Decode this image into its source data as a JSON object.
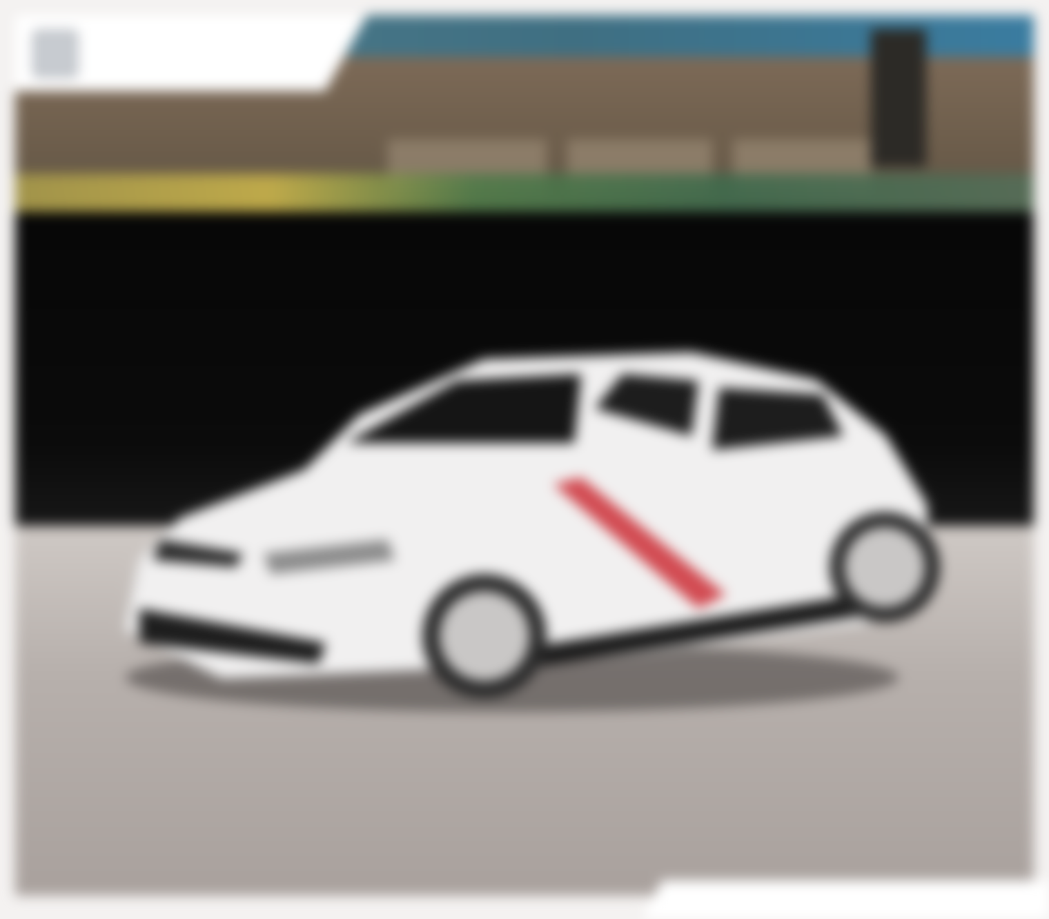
{
  "brand": {
    "badge_icon": "lion-badge-icon",
    "wordmark": "",
    "wordmark_color": "#d32637"
  },
  "caption": "",
  "colors": {
    "car_body": "#f2f2f2",
    "stripe": "#d24b52",
    "background_dark": "#080808",
    "ground": "#b7b0ac"
  }
}
